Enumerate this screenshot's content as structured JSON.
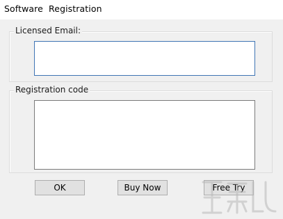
{
  "window": {
    "title": "Software  Registration"
  },
  "email_group": {
    "label": "Licensed Email:",
    "input_value": ""
  },
  "code_group": {
    "label": "Registration code",
    "input_value": ""
  },
  "buttons": {
    "ok": "OK",
    "buy_now": "Buy Now",
    "free_try": "Free Try"
  },
  "colors": {
    "window_bg": "#f0f0f0",
    "titlebar_bg": "#ffffff",
    "focus_border": "#3f74b4",
    "button_bg": "#e1e1e1"
  }
}
